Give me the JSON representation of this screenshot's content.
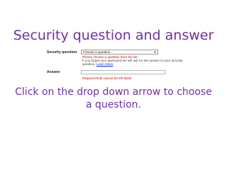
{
  "slide": {
    "title": "Security question and answer",
    "instruction_line1": "Click on the drop down arrow to choose",
    "instruction_line2": "a question."
  },
  "form": {
    "question_label": "Security question:",
    "question_select_value": "Choose a question...",
    "question_error": "Please choose a question from the list.",
    "help_line1": "If you forget your password we will ask for the answer to your security",
    "help_line2": "question.",
    "learn_more": "Learn More",
    "answer_label": "Answer:",
    "answer_value": "",
    "answer_error": "Required field cannot be left blank"
  },
  "colors": {
    "title": "#7030a0",
    "error": "#d40000",
    "link": "#0033cc"
  },
  "icons": {
    "dropdown_arrow": "chevron-down-icon"
  }
}
